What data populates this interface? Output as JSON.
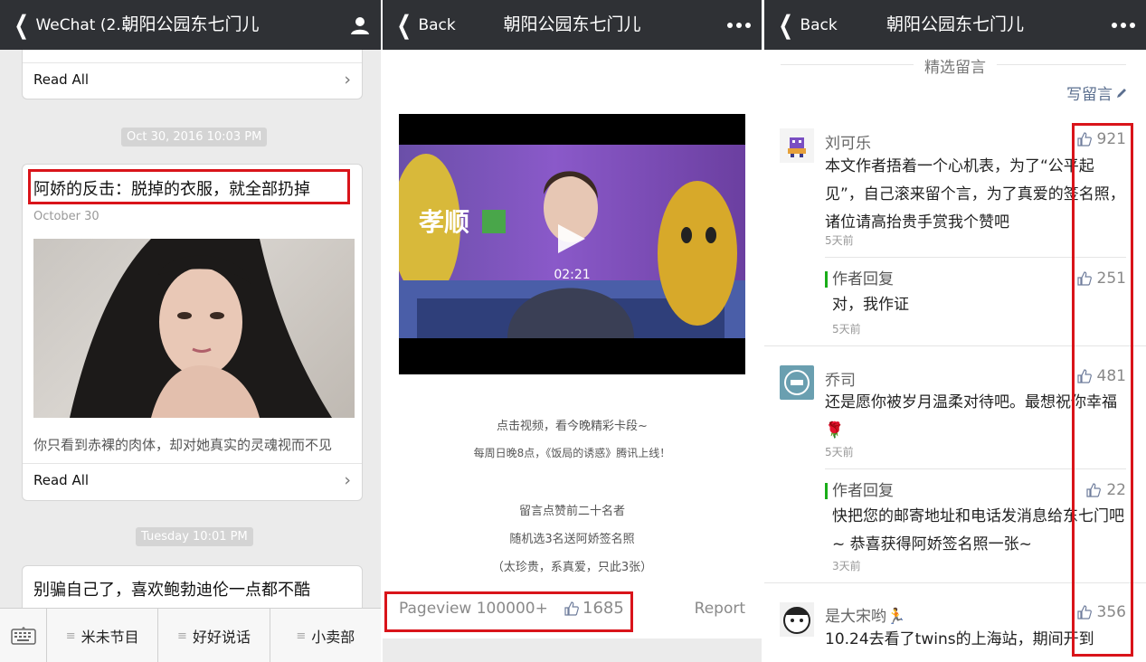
{
  "panel1": {
    "nav": {
      "back_label": "WeChat (2...",
      "title": "朝阳公园东七门儿"
    },
    "top_card": {
      "read_all": "Read All"
    },
    "stamp1": "Oct 30, 2016 10:03 PM",
    "article": {
      "title": "阿娇的反击：脱掉的衣服，就全部扔掉",
      "date": "October 30",
      "summary": "你只看到赤裸的肉体，却对她真实的灵魂视而不见",
      "read_all": "Read All"
    },
    "stamp2": "Tuesday 10:01 PM",
    "article2": {
      "title": "别骗自己了，喜欢鲍勃迪伦一点都不酷"
    },
    "bottom_menu": [
      "米未节目",
      "好好说话",
      "小卖部"
    ]
  },
  "panel2": {
    "nav": {
      "back_label": "Back",
      "title": "朝阳公园东七门儿"
    },
    "video": {
      "duration": "02:21",
      "overlay_text": "孝顺"
    },
    "caption_lines": [
      "点击视频，看今晚精彩卡段~",
      "每周日晚8点，《饭局的诱惑》腾讯上线！"
    ],
    "promo_lines": [
      "留言点赞前二十名者",
      "随机选3名送阿娇签名照",
      "（太珍贵，系真爱，只此3张）"
    ],
    "footer": {
      "pageview": "Pageview 100000+",
      "likes": "1685",
      "report": "Report"
    }
  },
  "panel3": {
    "nav": {
      "back_label": "Back",
      "title": "朝阳公园东七门儿"
    },
    "section_title": "精选留言",
    "write_comment": "写留言",
    "comments": [
      {
        "name": "刘可乐",
        "body": "本文作者捂着一个心机表，为了“公平起见”，自己滚来留个言，为了真爱的签名照，诸位请高抬贵手赏我个赞吧",
        "time": "5天前",
        "likes": "921"
      },
      {
        "reply_label": "作者回复",
        "body": "对，我作证",
        "time": "5天前",
        "likes": "251"
      },
      {
        "name": "乔司",
        "body": "还是愿你被岁月温柔对待吧。最想祝你幸福🌹",
        "time": "5天前",
        "likes": "481"
      },
      {
        "reply_label": "作者回复",
        "body": "快把您的邮寄地址和电话发消息给东七门吧~ 恭喜获得阿娇签名照一张~",
        "time": "3天前",
        "likes": "22"
      },
      {
        "name": "是大宋哟🏃",
        "body": "10.24去看了twins的上海站，期间开到",
        "likes": "356"
      }
    ]
  },
  "colors": {
    "nav_bg": "#2f3135",
    "highlight": "#d9141a",
    "reply_accent": "#1aad19"
  }
}
